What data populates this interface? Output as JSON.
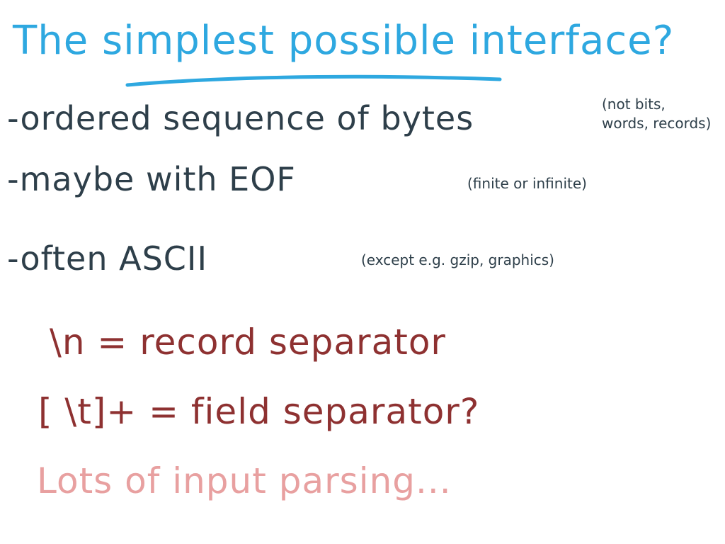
{
  "slide": {
    "title": "The simplest possible interface?",
    "colors": {
      "title": "#2ea8e0",
      "bullets": "#2e3f4a",
      "red_text": "#8e3131",
      "pink_text": "#e8a0a0"
    },
    "bullets": [
      {
        "text": "-ordered sequence of bytes",
        "note_line1": "(not bits,",
        "note_line2": "words, records)"
      },
      {
        "text": "-maybe with EOF",
        "note": "(finite or infinite)"
      },
      {
        "text": "-often ASCII",
        "note": "(except e.g. gzip, graphics)"
      }
    ],
    "separators": [
      "\\n = record separator",
      "[ \\t]+ = field separator?"
    ],
    "footer": "Lots of input parsing..."
  }
}
